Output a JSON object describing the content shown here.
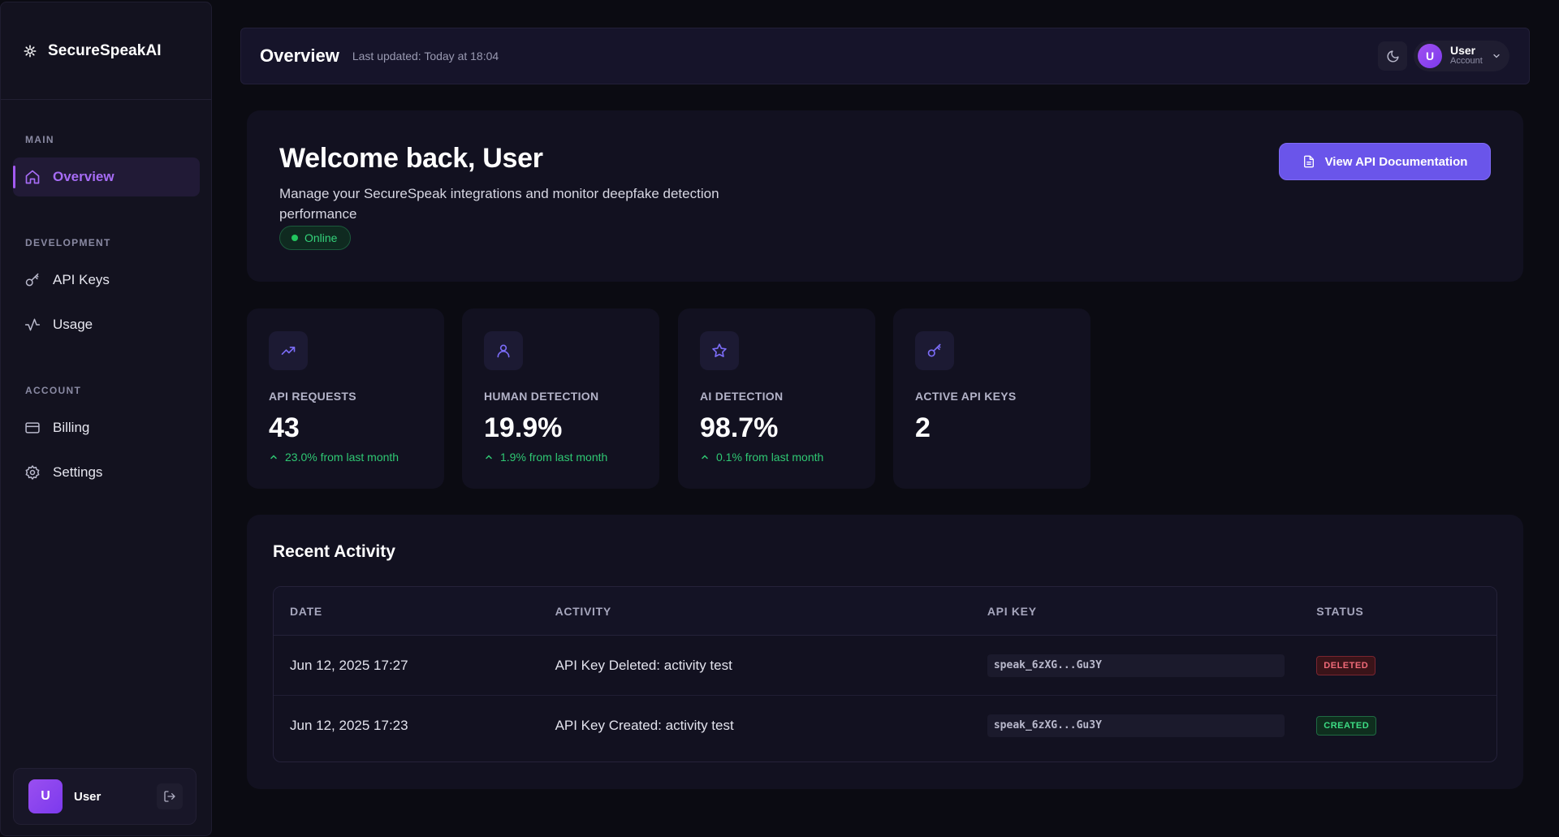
{
  "sidebar": {
    "brand": "SecureSpeakAI",
    "sections": [
      {
        "title": "MAIN",
        "items": [
          {
            "label": "Overview",
            "icon": "home-icon",
            "active": true
          }
        ]
      },
      {
        "title": "DEVELOPMENT",
        "items": [
          {
            "label": "API Keys",
            "icon": "key-icon"
          },
          {
            "label": "Usage",
            "icon": "activity-icon"
          }
        ]
      },
      {
        "title": "ACCOUNT",
        "items": [
          {
            "label": "Billing",
            "icon": "credit-card-icon"
          },
          {
            "label": "Settings",
            "icon": "gear-icon"
          }
        ]
      }
    ],
    "user": {
      "initial": "U",
      "name": "User"
    }
  },
  "header": {
    "title": "Overview",
    "last_updated": "Last updated: Today at 18:04",
    "account": {
      "initial": "U",
      "name": "User",
      "sub": "Account"
    }
  },
  "welcome": {
    "title": "Welcome back, User",
    "description": "Manage your SecureSpeak integrations and monitor deepfake detection performance",
    "status": "Online",
    "docs_button": "View API Documentation"
  },
  "stats": [
    {
      "label": "API REQUESTS",
      "value": "43",
      "change": "23.0% from last month",
      "icon": "trending-up-icon"
    },
    {
      "label": "HUMAN DETECTION",
      "value": "19.9%",
      "change": "1.9% from last month",
      "icon": "user-icon"
    },
    {
      "label": "AI DETECTION",
      "value": "98.7%",
      "change": "0.1% from last month",
      "icon": "star-icon"
    },
    {
      "label": "ACTIVE API KEYS",
      "value": "2",
      "change": "",
      "icon": "key-icon"
    }
  ],
  "activity": {
    "title": "Recent Activity",
    "columns": [
      "DATE",
      "ACTIVITY",
      "API KEY",
      "STATUS"
    ],
    "rows": [
      {
        "date": "Jun 12, 2025 17:27",
        "activity": "API Key Deleted: activity test",
        "api_key": "speak_6zXG...Gu3Y",
        "status": "DELETED"
      },
      {
        "date": "Jun 12, 2025 17:23",
        "activity": "API Key Created: activity test",
        "api_key": "speak_6zXG...Gu3Y",
        "status": "CREATED"
      }
    ]
  },
  "colors": {
    "accent": "#a66cf5",
    "button": "#6a55ea",
    "success": "#2fc873",
    "danger": "#f06a78"
  }
}
